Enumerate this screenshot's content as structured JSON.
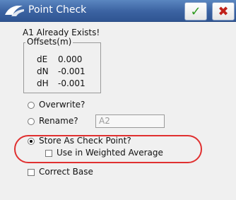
{
  "titlebar": {
    "title": "Point Check",
    "ok_symbol": "✓",
    "cancel_symbol": "✖"
  },
  "message": "A1 Already Exists!",
  "offsets": {
    "legend": "Offsets(m)",
    "rows": [
      {
        "label": "dE",
        "value": "0.000"
      },
      {
        "label": "dN",
        "value": "-0.001"
      },
      {
        "label": "dH",
        "value": "-0.001"
      }
    ]
  },
  "options": {
    "overwrite": "Overwrite?",
    "rename": "Rename?",
    "rename_value": "A2",
    "store": "Store As Check Point?",
    "weighted": "Use in Weighted Average",
    "correct_base": "Correct Base"
  },
  "colors": {
    "accent": "#3b62a1",
    "ok": "#2e9a1e",
    "cancel": "#c0211a",
    "highlight": "#e03030"
  }
}
